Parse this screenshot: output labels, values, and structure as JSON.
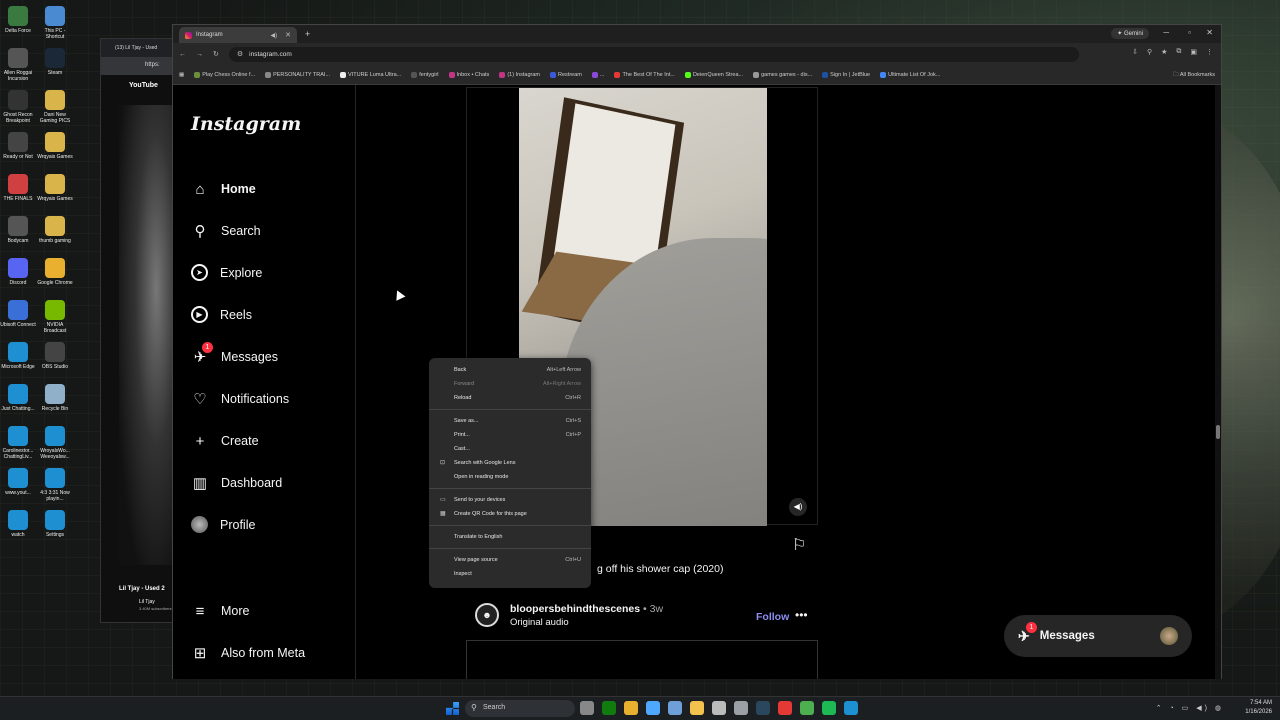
{
  "desktop": {
    "icons": [
      {
        "label": "Delta Force",
        "color": "#3a7a40"
      },
      {
        "label": "This PC - Shortcut",
        "color": "#4a8ad0"
      },
      {
        "label": "Allen Roggai Incursion",
        "color": "#555"
      },
      {
        "label": "Steam",
        "color": "#1b2838"
      },
      {
        "label": "Ghost Recon Breakpoint",
        "color": "#333"
      },
      {
        "label": "Dani New Gaming PICS",
        "color": "#d9b44a"
      },
      {
        "label": "Ready or Not",
        "color": "#444"
      },
      {
        "label": "Wrqyais Games",
        "color": "#d9b44a"
      },
      {
        "label": "THE FINALS",
        "color": "#d04040"
      },
      {
        "label": "Wrqyais Games",
        "color": "#d9b44a"
      },
      {
        "label": "Bodycam",
        "color": "#555"
      },
      {
        "label": "thumb gaming",
        "color": "#d9b44a"
      },
      {
        "label": "Discord",
        "color": "#5865f2"
      },
      {
        "label": "Google Chrome",
        "color": "#e8b02e"
      },
      {
        "label": "Ubisoft Connect",
        "color": "#3a6fd8"
      },
      {
        "label": "NVIDIA Broadcast",
        "color": "#76b900"
      },
      {
        "label": "Microsoft Edge",
        "color": "#1e8fd0"
      },
      {
        "label": "OBS Studio",
        "color": "#444"
      },
      {
        "label": "Just Chatting...",
        "color": "#1e8fd0"
      },
      {
        "label": "Recycle Bin",
        "color": "#8fb0c8"
      },
      {
        "label": "Carolinestor... ChattingLiv...",
        "color": "#1e8fd0"
      },
      {
        "label": "WroyalsWo... Weeoyalsw...",
        "color": "#1e8fd0"
      },
      {
        "label": "www.yout...",
        "color": "#1e8fd0"
      },
      {
        "label": "4:3 3:31 Now playin...",
        "color": "#1e8fd0"
      },
      {
        "label": "watch",
        "color": "#1e8fd0"
      },
      {
        "label": "Settings",
        "color": "#1e8fd0"
      }
    ]
  },
  "bg_window": {
    "tab_title": "(13) Lil Tjay - Used",
    "url": "https:",
    "brand": "YouTube",
    "video_title": "Lil Tjay - Used 2",
    "channel": "Lil Tjay",
    "subs": "3.40M subscribers"
  },
  "browser": {
    "tab_title": "Instagram",
    "gemini_label": "Gemini",
    "url": "instagram.com",
    "bookmarks": [
      {
        "label": "Play Chess Online f...",
        "color": "#6b8f3a"
      },
      {
        "label": "PERSONALITY TRAI...",
        "color": "#888"
      },
      {
        "label": "VITURE Luma Ultra...",
        "color": "#eee"
      },
      {
        "label": "fentygirl",
        "color": "#555"
      },
      {
        "label": "Inbox • Chats",
        "color": "#c13584"
      },
      {
        "label": "(1) Instagram",
        "color": "#c13584"
      },
      {
        "label": "Restream",
        "color": "#3a5ad8"
      },
      {
        "label": "...",
        "color": "#8a4ad8"
      },
      {
        "label": "The Best Of The Int...",
        "color": "#e53935"
      },
      {
        "label": "DeienQueen Strea...",
        "color": "#53fc18"
      },
      {
        "label": "games games - dis...",
        "color": "#999"
      },
      {
        "label": "Sign In | JetBlue",
        "color": "#1e4fa0"
      },
      {
        "label": "Ultimate List Of Jok...",
        "color": "#4285f4"
      }
    ],
    "all_bookmarks": "All Bookmarks"
  },
  "instagram": {
    "logo": "Instagram",
    "nav": [
      {
        "key": "home",
        "label": "Home",
        "icon": "home-icon",
        "glyph": "⌂"
      },
      {
        "key": "search",
        "label": "Search",
        "icon": "search-icon",
        "glyph": "⚲"
      },
      {
        "key": "explore",
        "label": "Explore",
        "icon": "compass-icon",
        "glyph": "➤"
      },
      {
        "key": "reels",
        "label": "Reels",
        "icon": "reels-icon",
        "glyph": "▶"
      },
      {
        "key": "messages",
        "label": "Messages",
        "icon": "messenger-icon",
        "glyph": "✈",
        "badge": "1"
      },
      {
        "key": "notifications",
        "label": "Notifications",
        "icon": "heart-icon",
        "glyph": "♡"
      },
      {
        "key": "create",
        "label": "Create",
        "icon": "plus-icon",
        "glyph": "+"
      },
      {
        "key": "dashboard",
        "label": "Dashboard",
        "icon": "dashboard-icon",
        "glyph": "▥"
      },
      {
        "key": "profile",
        "label": "Profile",
        "icon": "avatar",
        "glyph": ""
      }
    ],
    "more": {
      "label": "More",
      "glyph": "≡"
    },
    "also_meta": {
      "label": "Also from Meta",
      "glyph": "⊞"
    },
    "post_caption": "g off his shower cap (2020)",
    "post2": {
      "username": "bloopersbehindthescenes",
      "time": "• 3w",
      "audio": "Original audio",
      "follow": "Follow",
      "more": "•••"
    },
    "floating_messages": {
      "label": "Messages",
      "badge": "1"
    }
  },
  "context_menu": {
    "groups": [
      [
        {
          "label": "Back",
          "shortcut": "Alt+Left Arrow",
          "disabled": false,
          "icon": ""
        },
        {
          "label": "Forward",
          "shortcut": "Alt+Right Arrow",
          "disabled": true,
          "icon": ""
        },
        {
          "label": "Reload",
          "shortcut": "Ctrl+R",
          "disabled": false,
          "icon": ""
        }
      ],
      [
        {
          "label": "Save as...",
          "shortcut": "Ctrl+S",
          "disabled": false,
          "icon": ""
        },
        {
          "label": "Print...",
          "shortcut": "Ctrl+P",
          "disabled": false,
          "icon": ""
        },
        {
          "label": "Cast...",
          "shortcut": "",
          "disabled": false,
          "icon": ""
        },
        {
          "label": "Search with Google Lens",
          "shortcut": "",
          "disabled": false,
          "icon": "⊡"
        },
        {
          "label": "Open in reading mode",
          "shortcut": "",
          "disabled": false,
          "icon": ""
        }
      ],
      [
        {
          "label": "Send to your devices",
          "shortcut": "",
          "disabled": false,
          "icon": "▭"
        },
        {
          "label": "Create QR Code for this page",
          "shortcut": "",
          "disabled": false,
          "icon": "▦"
        }
      ],
      [
        {
          "label": "Translate to English",
          "shortcut": "",
          "disabled": false,
          "icon": ""
        }
      ],
      [
        {
          "label": "View page source",
          "shortcut": "Ctrl+U",
          "disabled": false,
          "icon": ""
        },
        {
          "label": "Inspect",
          "shortcut": "",
          "disabled": false,
          "icon": ""
        }
      ]
    ]
  },
  "taskbar": {
    "search_label": "Search",
    "time": "7:54 AM",
    "date": "1/16/2026",
    "apps": [
      {
        "name": "taskview-app",
        "color": "#888"
      },
      {
        "name": "xbox-app",
        "color": "#107c10"
      },
      {
        "name": "files-app",
        "color": "#e8b02e"
      },
      {
        "name": "copilot-app",
        "color": "#4fa8ff"
      },
      {
        "name": "widgets-app",
        "color": "#6f9fd8"
      },
      {
        "name": "explorer-app",
        "color": "#f2c14e"
      },
      {
        "name": "store-app",
        "color": "#bbb"
      },
      {
        "name": "settings-app",
        "color": "#9aa0a6"
      },
      {
        "name": "steam-app",
        "color": "#2a475e"
      },
      {
        "name": "chrome-app",
        "color": "#e53935"
      },
      {
        "name": "chrome-active-app",
        "color": "#4caf50"
      },
      {
        "name": "spotify-app",
        "color": "#1db954"
      },
      {
        "name": "edge-app",
        "color": "#1e8fd0"
      }
    ]
  }
}
